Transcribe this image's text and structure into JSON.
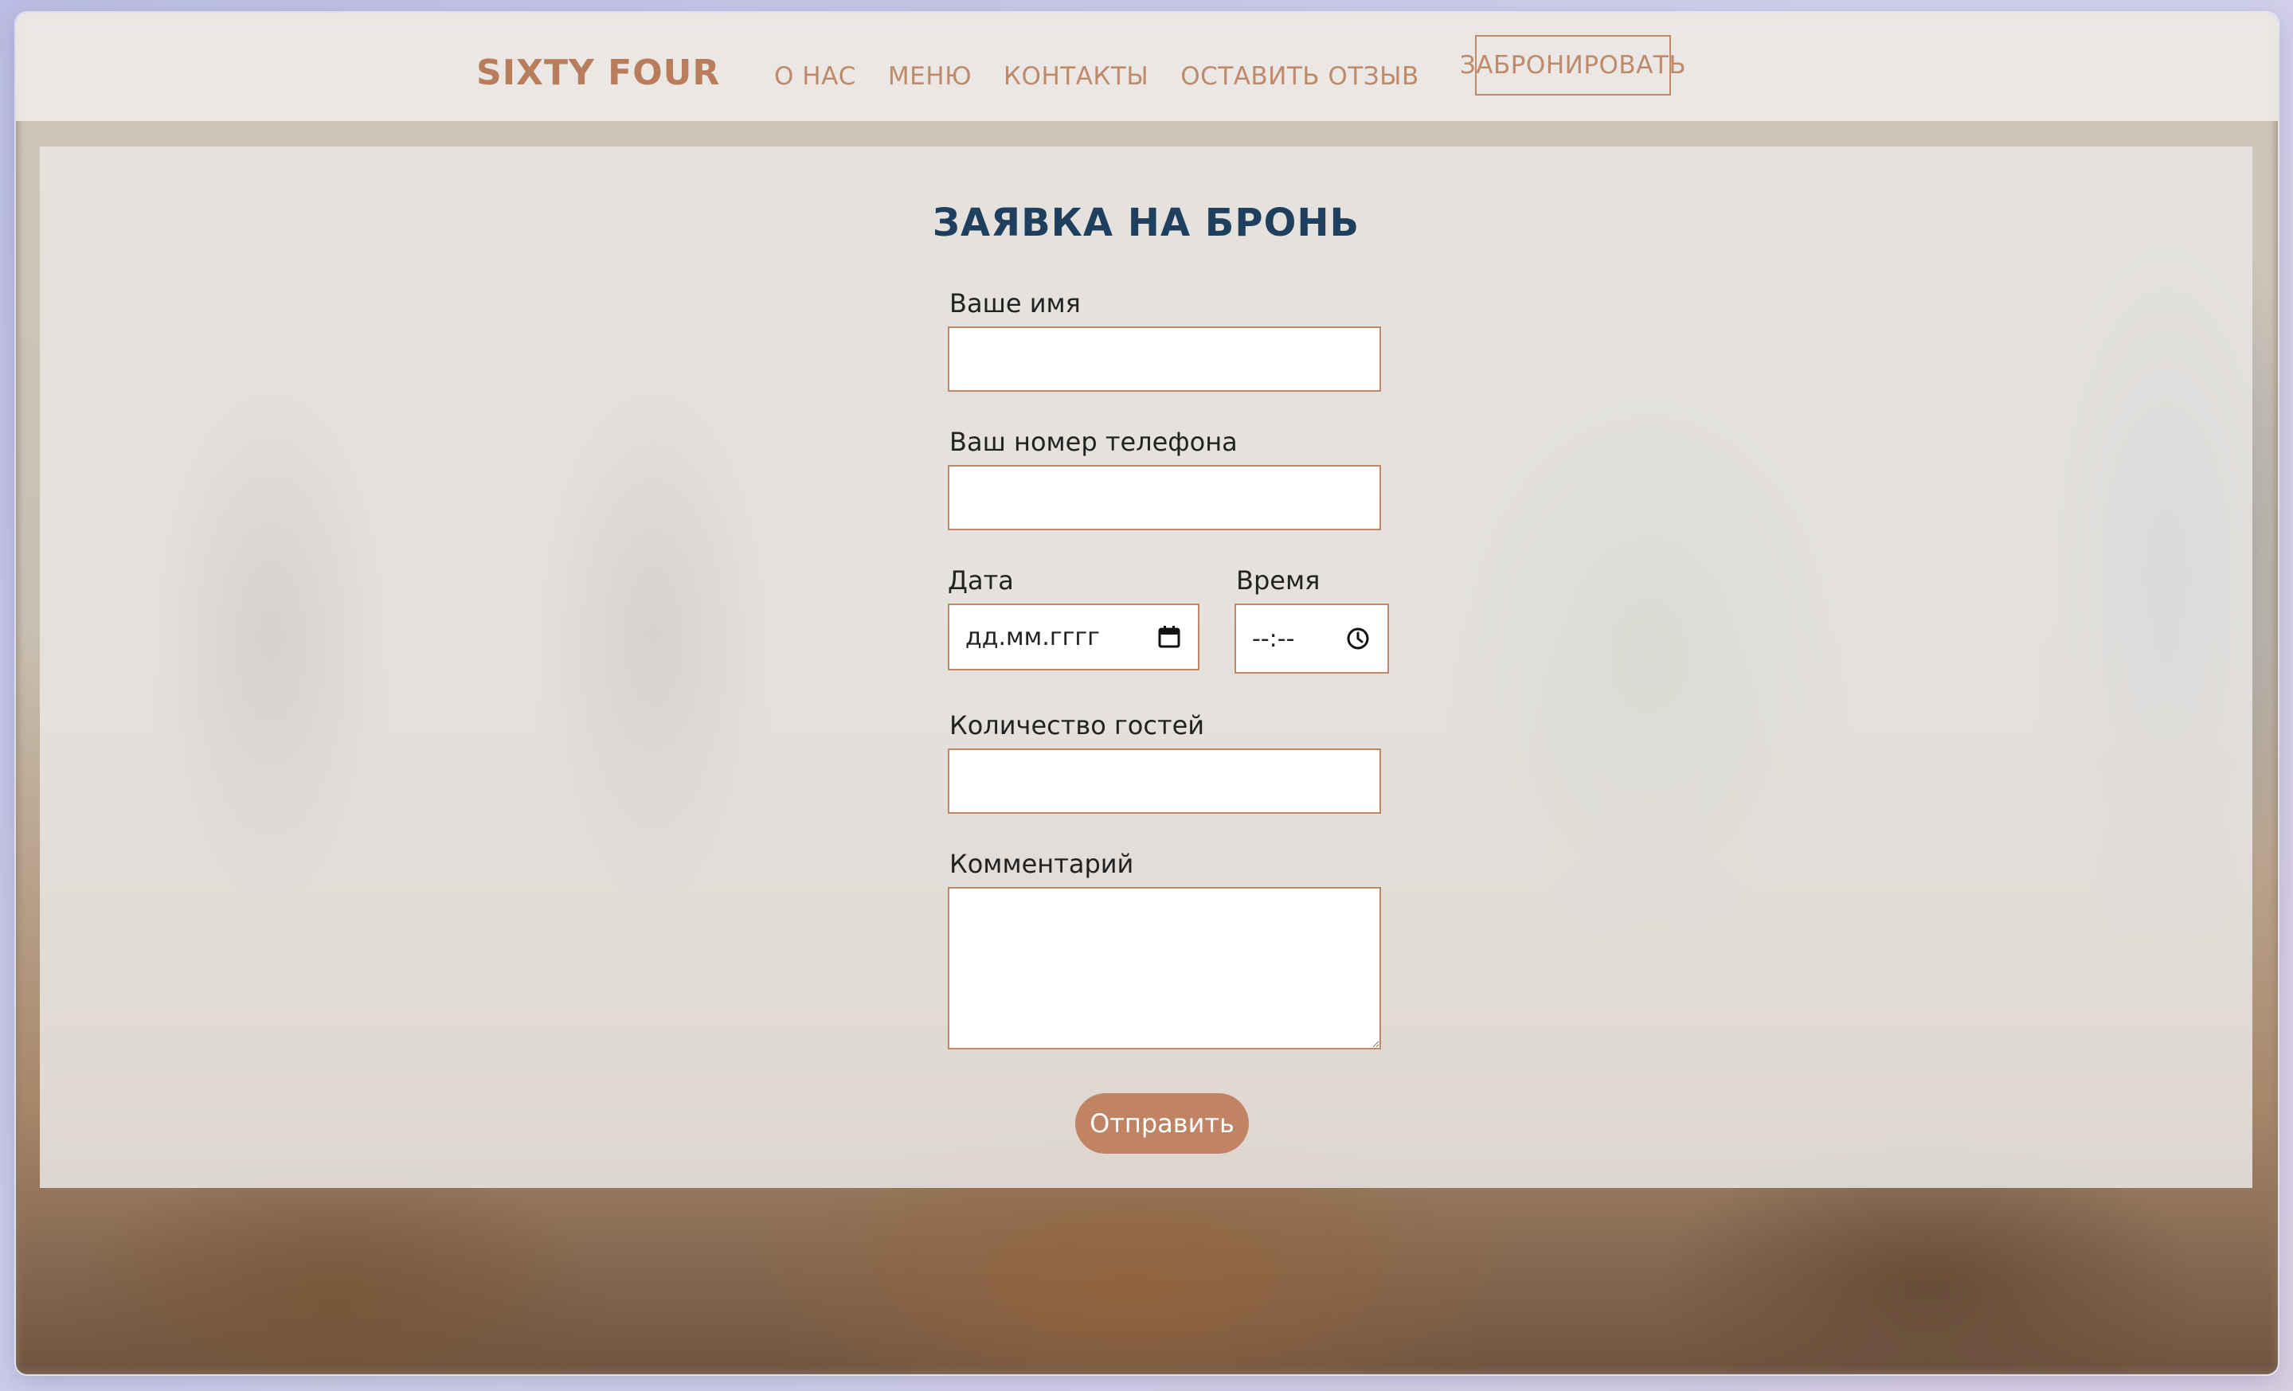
{
  "header": {
    "brand": "SIXTY FOUR",
    "nav": [
      "О НАС",
      "МЕНЮ",
      "КОНТАКТЫ",
      "ОСТАВИТЬ ОТЗЫВ"
    ],
    "book_button": "ЗАБРОНИРОВАТЬ"
  },
  "form": {
    "title": "ЗАЯВКА НА БРОНЬ",
    "name_label": "Ваше имя",
    "name_value": "",
    "phone_label": "Ваш номер телефона",
    "phone_value": "",
    "date_label": "Дата",
    "date_placeholder": "дд.мм.гггг",
    "time_label": "Время",
    "time_placeholder": "--:--",
    "guests_label": "Количество гостей",
    "guests_value": "",
    "comment_label": "Комментарий",
    "comment_value": "",
    "submit_label": "Отправить"
  },
  "colors": {
    "accent": "#c08464",
    "title": "#1f3f5e",
    "nav_text": "#bf8a6a"
  },
  "icons": {
    "date": "calendar-icon",
    "time": "clock-icon"
  }
}
